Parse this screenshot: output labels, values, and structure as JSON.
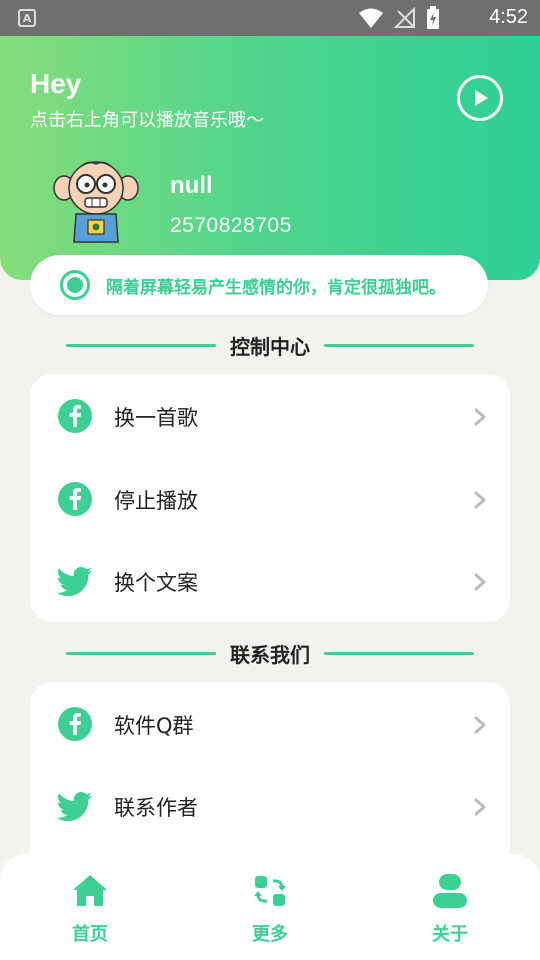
{
  "status_bar": {
    "app_icon_letter": "A",
    "time": "4:52"
  },
  "header": {
    "greeting": "Hey",
    "subtitle": "点击右上角可以播放音乐哦～",
    "user_name": "null",
    "user_id": "2570828705"
  },
  "quote": {
    "text": "隔着屏幕轻易产生感情的你，肯定很孤独吧。"
  },
  "control_section": {
    "title": "控制中心",
    "items": [
      {
        "label": "换一首歌",
        "icon": "facebook-icon"
      },
      {
        "label": "停止播放",
        "icon": "facebook-icon"
      },
      {
        "label": "换个文案",
        "icon": "twitter-icon"
      }
    ]
  },
  "contact_section": {
    "title": "联系我们",
    "items": [
      {
        "label": "软件Q群",
        "icon": "facebook-icon"
      },
      {
        "label": "联系作者",
        "icon": "twitter-icon"
      }
    ]
  },
  "tab_bar": {
    "items": [
      {
        "label": "首页",
        "icon": "home-icon"
      },
      {
        "label": "更多",
        "icon": "refresh-grid-icon"
      },
      {
        "label": "关于",
        "icon": "person-icon"
      }
    ]
  },
  "colors": {
    "accent": "#3dcf93",
    "header_gradient_start": "#86dd7a",
    "header_gradient_end": "#2dcf98"
  }
}
